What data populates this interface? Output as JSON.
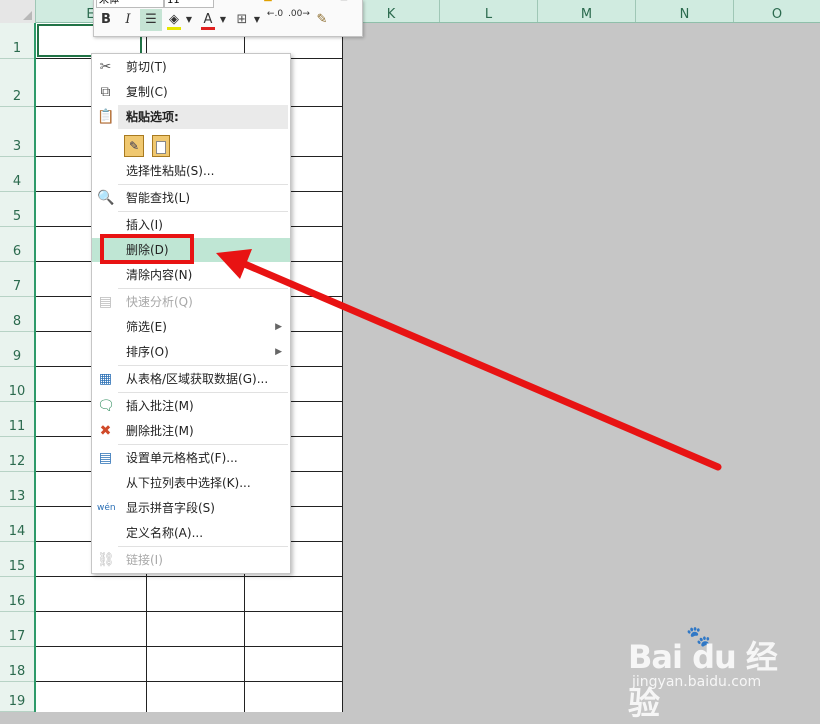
{
  "column_headers": [
    "E",
    "",
    "",
    "K",
    "L",
    "M",
    "N",
    "O"
  ],
  "row_headers": [
    "1",
    "2",
    "3",
    "4",
    "5",
    "6",
    "7",
    "8",
    "9",
    "10",
    "11",
    "12",
    "13",
    "14",
    "15",
    "16",
    "17",
    "18",
    "19"
  ],
  "mini_toolbar": {
    "font_name": "宋体",
    "font_size": "11",
    "bold_label": "B",
    "italic_label": "I",
    "font_color_label": "A",
    "percent_label": "%",
    "decrease_decimal_label": ".00",
    "increase_decimal_label": ".0"
  },
  "context_menu": {
    "cut": "剪切(T)",
    "copy": "复制(C)",
    "paste_options_header": "粘贴选项:",
    "paste_special": "选择性粘贴(S)...",
    "smart_lookup": "智能查找(L)",
    "insert": "插入(I)",
    "delete": "删除(D)",
    "clear_contents": "清除内容(N)",
    "quick_analysis": "快速分析(Q)",
    "filter": "筛选(E)",
    "sort": "排序(O)",
    "get_data_from_table": "从表格/区域获取数据(G)...",
    "insert_comment": "插入批注(M)",
    "delete_comment": "删除批注(M)",
    "format_cells": "设置单元格格式(F)...",
    "pick_from_dropdown": "从下拉列表中选择(K)...",
    "show_phonetic": "显示拼音字段(S)",
    "define_name": "定义名称(A)...",
    "link": "链接(I)"
  },
  "watermark": {
    "brand": "Bai du 经验",
    "url": "jingyan.baidu.com"
  },
  "colors": {
    "accent_green": "#217346",
    "highlight": "#bfe6d4",
    "annotation_red": "#e81313"
  }
}
